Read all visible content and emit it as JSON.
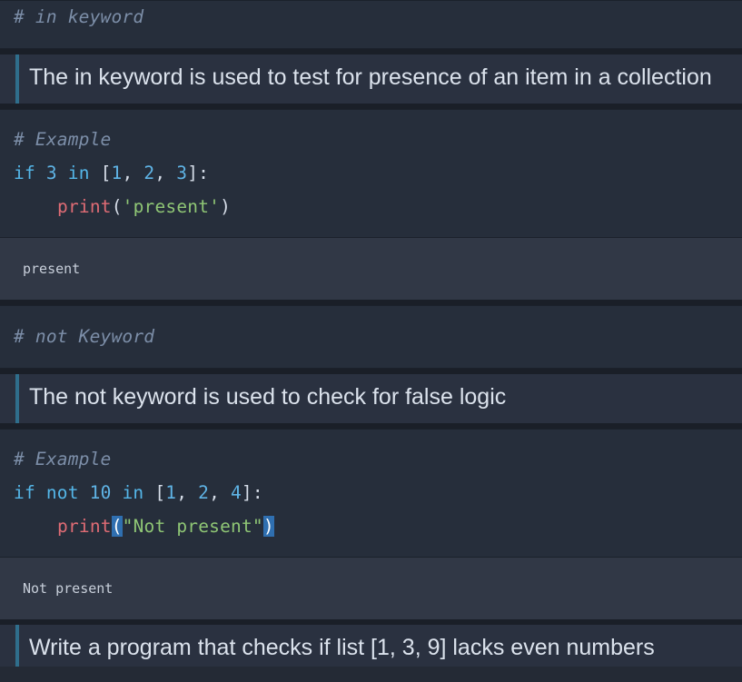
{
  "cells": {
    "c1": {
      "comment": "# in keyword"
    },
    "m1": {
      "text": "The in keyword is used to test for presence of an item in a collection"
    },
    "c2": {
      "comment": "# Example",
      "line2": {
        "kw1": "if",
        "num1": "3",
        "kw2": "in",
        "open": "[",
        "n1": "1",
        "n2": "2",
        "n3": "3",
        "close": "]:"
      },
      "line3": {
        "fn": "print",
        "open": "(",
        "str": "'present'",
        "close": ")"
      }
    },
    "o2": {
      "text": "present"
    },
    "c3": {
      "comment": "# not Keyword"
    },
    "m2": {
      "text": "The not keyword is used to check for false logic"
    },
    "c4": {
      "comment": "# Example",
      "line2": {
        "kw1": "if",
        "kw2": "not",
        "num1": "10",
        "kw3": "in",
        "open": "[",
        "n1": "1",
        "n2": "2",
        "n3": "4",
        "close": "]:"
      },
      "line3": {
        "fn": "print",
        "open": "(",
        "str": "\"Not present\"",
        "close": ")"
      }
    },
    "o4": {
      "text": "Not present"
    },
    "m3": {
      "text": "Write a program that checks if list [1, 3, 9] lacks even numbers"
    }
  },
  "colors": {
    "keyword": "#54b6e8",
    "number": "#5fb4e6",
    "function": "#e06c75",
    "string": "#8fc675",
    "comment": "#7c8ea8",
    "markdown_bar": "#2f6e8c",
    "bracket_highlight": "#2f6fb0"
  }
}
